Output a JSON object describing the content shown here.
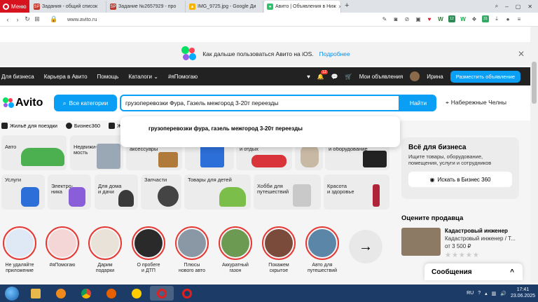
{
  "browser": {
    "menu_label": "Меню",
    "tabs": [
      {
        "label": "Задания - общий список",
        "icon_text": "SP",
        "color": "#c0392b"
      },
      {
        "label": "Задание №2657929 - про",
        "icon_text": "SP",
        "color": "#c0392b"
      },
      {
        "label": "IMG_9725.jpg - Google Ди",
        "icon_text": "▲",
        "color": "#f4b400"
      },
      {
        "label": "Авито | Объявления в Ниж",
        "icon_text": "●",
        "color": "#2fc26b"
      }
    ],
    "url": "www.avito.ru",
    "ext_badge_1": "12",
    "ext_badge_2": "31"
  },
  "ios_banner": {
    "text": "Как дальше пользоваться Авито на iOS.",
    "link": "Подробнее"
  },
  "top_nav": {
    "items": [
      "Для бизнеса",
      "Карьера в Авито",
      "Помощь",
      "Каталоги",
      "#яПомогаю"
    ],
    "catalog_chevron": "⌄",
    "notif_count": "12",
    "my_ads": "Мои объявления",
    "user_name": "Ирина",
    "place_ad": "Разместить объявление"
  },
  "search": {
    "logo": "Avito",
    "categories_btn": "Все категории",
    "query": "грузоперевозки Фура, Газель межгород 3-20т переезды",
    "find_btn": "Найти",
    "city": "Набережные Челны",
    "suggestion": "грузоперевозки фура, газель межгород 3-20т переезды"
  },
  "chips": [
    "Жильё для поездки",
    "Бизнес360",
    "Жильё"
  ],
  "tiles_row1": [
    {
      "label": "Авто"
    },
    {
      "label": "Недвижи-\nмость"
    },
    {
      "label": "аксессуары"
    },
    {
      "label": "и отдых"
    },
    {
      "label": "и оборудование"
    }
  ],
  "tiles_row2": [
    {
      "label": "Услуги"
    },
    {
      "label": "Электро-\nника"
    },
    {
      "label": "Для дома\nи дачи"
    },
    {
      "label": "Запчасти"
    },
    {
      "label": "Товары для детей"
    },
    {
      "label": "Хобби для\nпутешествий"
    },
    {
      "label": "Красота\nи здоровье"
    }
  ],
  "business": {
    "title": "Всё для бизнеса",
    "desc": "Ищите товары, оборудование, помещения, услуги и сотрудников",
    "button": "Искать в Бизнес 360"
  },
  "stories": [
    {
      "label": "Не удаляйте\nприложение",
      "color": "#dfe9f5"
    },
    {
      "label": "#яПомогаю",
      "color": "#f4d6d6"
    },
    {
      "label": "Дарим\nподарки",
      "color": "#e9e2d8"
    },
    {
      "label": "О пробеге\nи ДТП",
      "color": "#2a2a2a"
    },
    {
      "label": "Плюсы\nнового авто",
      "color": "#8a98a6"
    },
    {
      "label": "Аккуратный\nгазон",
      "color": "#6d9a52"
    },
    {
      "label": "Покажем\nскрытое",
      "color": "#7a4a3a"
    },
    {
      "label": "Авто для\nпутешествий",
      "color": "#5b86a8"
    }
  ],
  "rate_seller": {
    "title": "Оцените продавца",
    "name": "Кадастровый инженер",
    "sub": "Кадастровый инженер / Т...",
    "price": "от 3 500 ₽",
    "stars": "★★★★★"
  },
  "messages": {
    "label": "Сообщения",
    "chevron": "^"
  },
  "taskbar": {
    "lang": "RU",
    "time": "17:41",
    "date": "23.06.2025"
  }
}
